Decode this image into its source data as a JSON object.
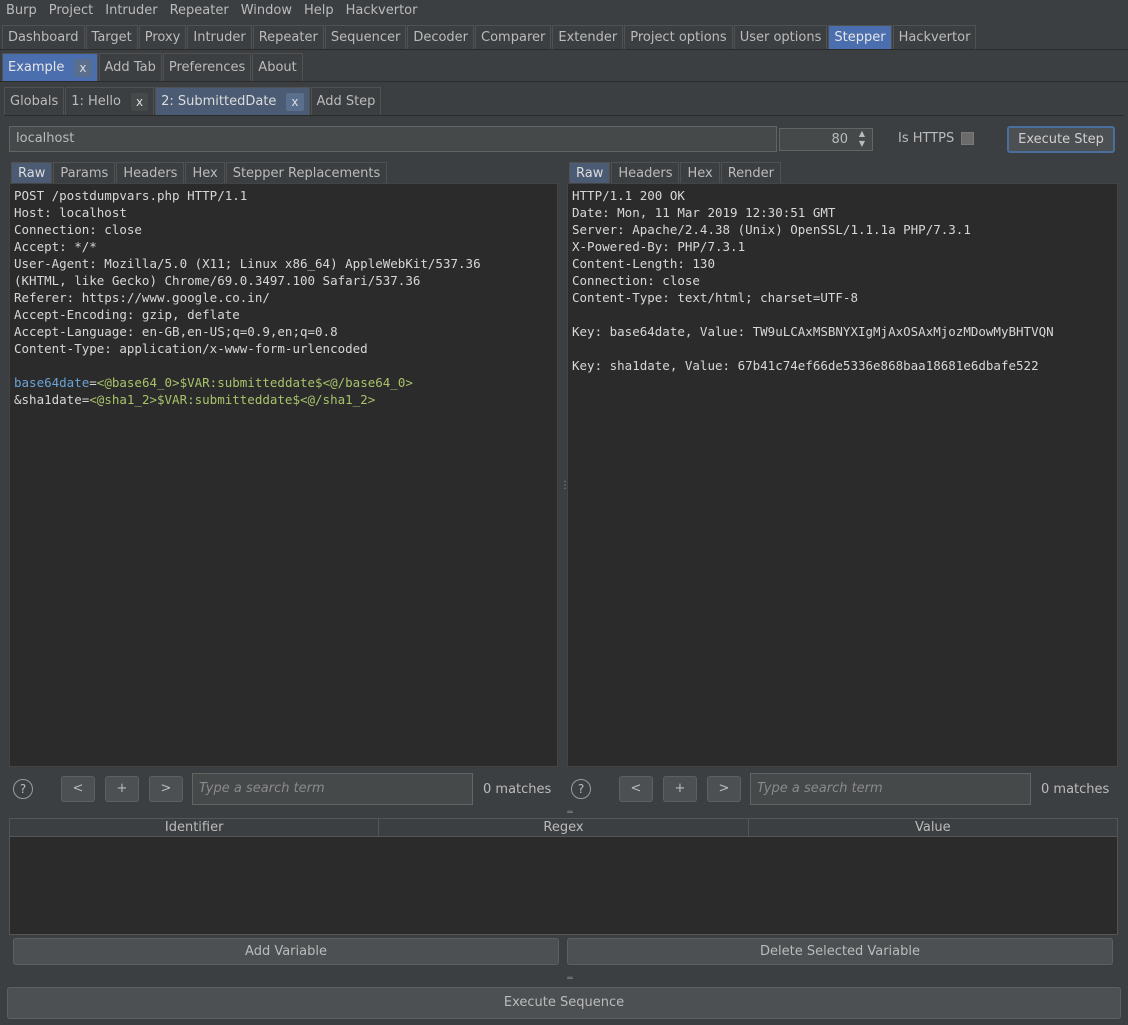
{
  "menubar": [
    "Burp",
    "Project",
    "Intruder",
    "Repeater",
    "Window",
    "Help",
    "Hackvertor"
  ],
  "main_tabs": [
    "Dashboard",
    "Target",
    "Proxy",
    "Intruder",
    "Repeater",
    "Sequencer",
    "Decoder",
    "Comparer",
    "Extender",
    "Project options",
    "User options",
    "Stepper",
    "Hackvertor"
  ],
  "main_tabs_active": "Stepper",
  "sequence_tabs": {
    "active_label": "Example",
    "close": "x",
    "add_tab": "Add Tab",
    "preferences": "Preferences",
    "about": "About"
  },
  "step_tabs": {
    "globals": "Globals",
    "step1": "1: Hello",
    "step2": "2: SubmittedDate",
    "close": "x",
    "add_step": "Add Step"
  },
  "request_target": {
    "host": "localhost",
    "port": "80",
    "https_label": "Is HTTPS",
    "https_checked": false,
    "execute_step": "Execute Step"
  },
  "request_pane": {
    "tabs": [
      "Raw",
      "Params",
      "Headers",
      "Hex",
      "Stepper Replacements"
    ],
    "active": "Raw",
    "lines": [
      "POST /postdumpvars.php HTTP/1.1",
      "Host: localhost",
      "Connection: close",
      "Accept: */*",
      "User-Agent: Mozilla/5.0 (X11; Linux x86_64) AppleWebKit/537.36",
      "(KHTML, like Gecko) Chrome/69.0.3497.100 Safari/537.36",
      "Referer: https://www.google.co.in/",
      "Accept-Encoding: gzip, deflate",
      "Accept-Language: en-GB,en-US;q=0.9,en;q=0.8",
      "Content-Type: application/x-www-form-urlencoded",
      ""
    ],
    "body": [
      {
        "name": "base64date",
        "eq": "=",
        "value": "<@base64_0>$VAR:submitteddate$<@/base64_0>"
      },
      {
        "name": "&sha1date",
        "eq": "=",
        "value": "<@sha1_2>$VAR:submitteddate$<@/sha1_2>"
      }
    ],
    "search_placeholder": "Type a search term",
    "matches": "0 matches"
  },
  "response_pane": {
    "tabs": [
      "Raw",
      "Headers",
      "Hex",
      "Render"
    ],
    "active": "Raw",
    "lines": [
      "HTTP/1.1 200 OK",
      "Date: Mon, 11 Mar 2019 12:30:51 GMT",
      "Server: Apache/2.4.38 (Unix) OpenSSL/1.1.1a PHP/7.3.1",
      "X-Powered-By: PHP/7.3.1",
      "Content-Length: 130",
      "Connection: close",
      "Content-Type: text/html; charset=UTF-8",
      "",
      "Key: base64date, Value: TW9uLCAxMSBNYXIgMjAxOSAxMjozMDowMyBHTVQN",
      "",
      "Key: sha1date, Value: 67b41c74ef66de5336e868baa18681e6dbafe522"
    ],
    "search_placeholder": "Type a search term",
    "matches": "0 matches"
  },
  "search_buttons": {
    "help": "?",
    "prev": "<",
    "add": "+",
    "next": ">"
  },
  "variables_table": {
    "columns": [
      "Identifier",
      "Regex",
      "Value"
    ],
    "rows": []
  },
  "add_variable": "Add Variable",
  "delete_variable": "Delete Selected Variable",
  "execute_sequence": "Execute Sequence",
  "colors": {
    "background": "#3c3f41",
    "editor_bg": "#2b2b2b",
    "active_tab": "#4b6eaf",
    "param_name": "#6aa2d6",
    "stepper_tag": "#a9c26a"
  }
}
